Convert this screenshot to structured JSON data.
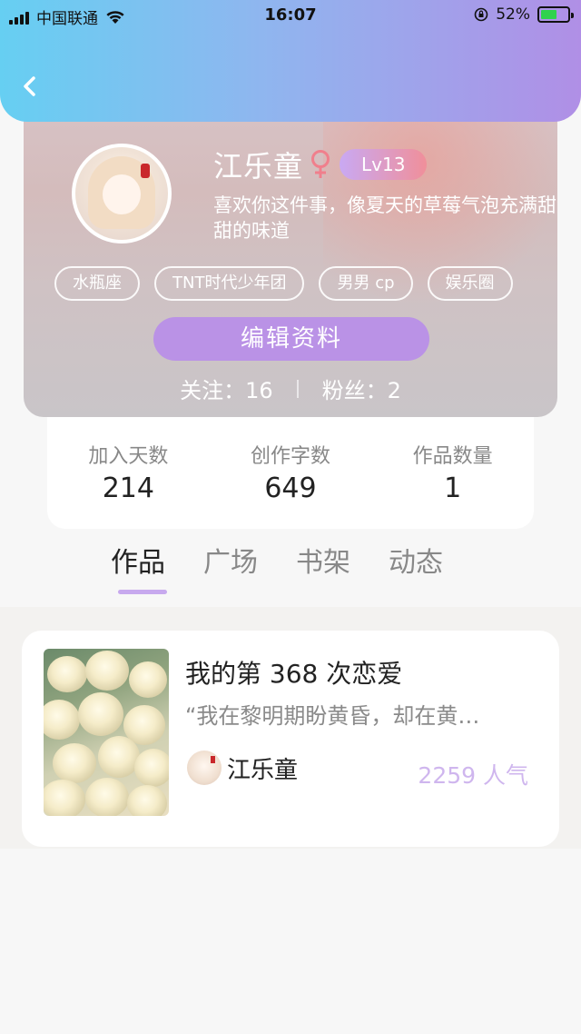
{
  "status_bar": {
    "carrier": "中国联通",
    "time": "16:07",
    "battery": "52%",
    "battery_level": 0.52
  },
  "profile": {
    "name": "江乐童",
    "gender_symbol": "♀",
    "level": "Lv13",
    "bio": "喜欢你这件事，像夏天的草莓气泡充满甜甜的味道",
    "tags": [
      "水瓶座",
      "TNT时代少年团",
      "男男 cp",
      "娱乐圈"
    ],
    "edit_button": "编辑资料",
    "following_label": "关注：",
    "following_count": "16",
    "followers_label": "粉丝：",
    "followers_count": "2"
  },
  "stats": [
    {
      "label": "加入天数",
      "value": "214"
    },
    {
      "label": "创作字数",
      "value": "649"
    },
    {
      "label": "作品数量",
      "value": "1"
    }
  ],
  "tabs": [
    {
      "label": "作品",
      "active": true
    },
    {
      "label": "广场",
      "active": false
    },
    {
      "label": "书架",
      "active": false
    },
    {
      "label": "动态",
      "active": false
    }
  ],
  "works": [
    {
      "title": "我的第 368 次恋爱",
      "excerpt": "“我在黎明期盼黄昏，却在黄…",
      "author": "江乐童",
      "popularity": "2259 人气"
    }
  ],
  "colors": {
    "header_gradient_start": "#66cff2",
    "header_gradient_end": "#b08fe6",
    "accent_purple": "#ba92e6",
    "level_badge_start": "#c9a9f3",
    "level_badge_end": "#f08f9a",
    "popularity": "#cfb6ee"
  }
}
